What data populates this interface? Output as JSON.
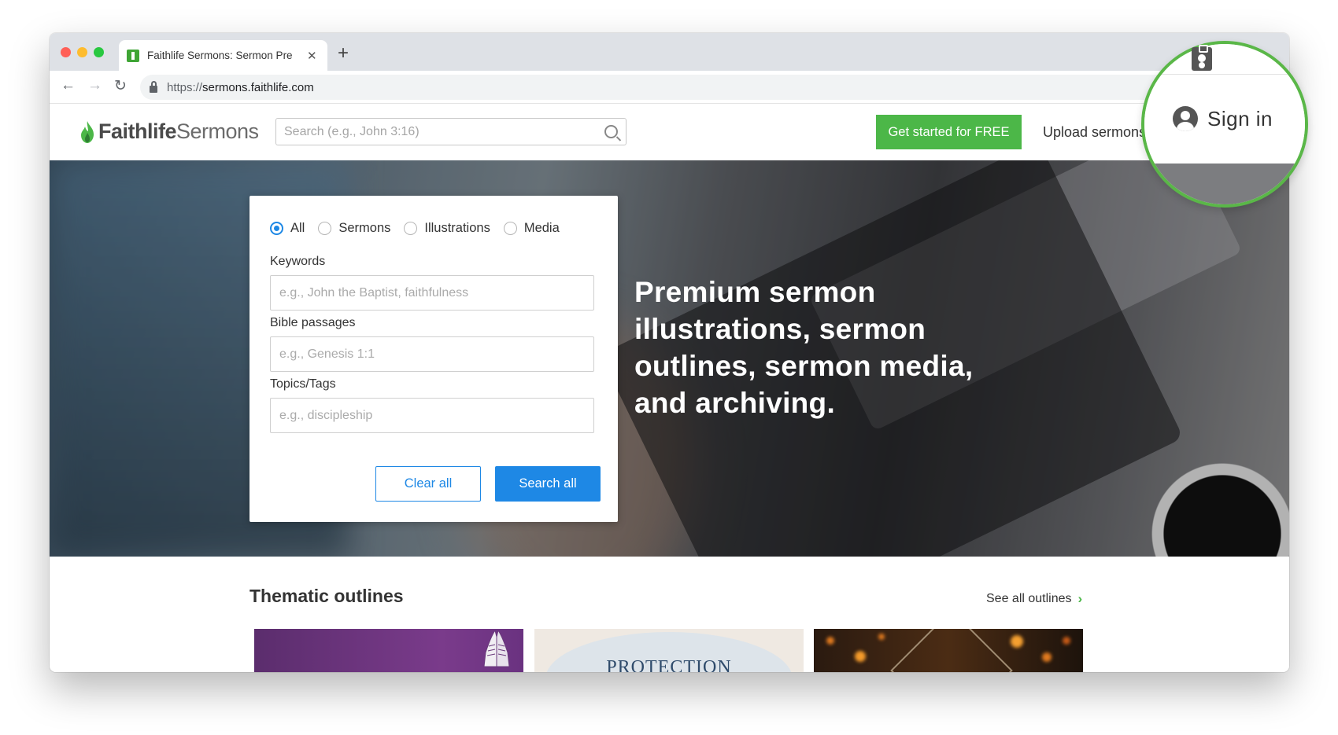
{
  "browser": {
    "tab_title": "Faithlife Sermons: Sermon Pre",
    "url_scheme": "https://",
    "url_host": "sermons.faithlife.com"
  },
  "header": {
    "logo_faithlife": "Faithlife",
    "logo_sermons": "Sermons",
    "search_placeholder": "Search (e.g., John 3:16)",
    "cta_label": "Get started for FREE",
    "upload_label": "Upload sermons",
    "signin_label": "Sign in"
  },
  "search_card": {
    "radio_options": [
      "All",
      "Sermons",
      "Illustrations",
      "Media"
    ],
    "selected": "All",
    "keywords_label": "Keywords",
    "keywords_placeholder": "e.g., John the Baptist, faithfulness",
    "passages_label": "Bible passages",
    "passages_placeholder": "e.g., Genesis 1:1",
    "topics_label": "Topics/Tags",
    "topics_placeholder": "e.g., discipleship",
    "clear_label": "Clear all",
    "search_label": "Search all"
  },
  "hero": {
    "heading": "Premium sermon illustrations, sermon outlines, sermon media, and archiving."
  },
  "outlines": {
    "title": "Thematic outlines",
    "see_all": "See all outlines",
    "card2_text": "PROTECTION"
  },
  "colors": {
    "brand_green": "#4cb748",
    "accent_blue": "#1e88e5",
    "highlight_ring": "#5ab748"
  }
}
